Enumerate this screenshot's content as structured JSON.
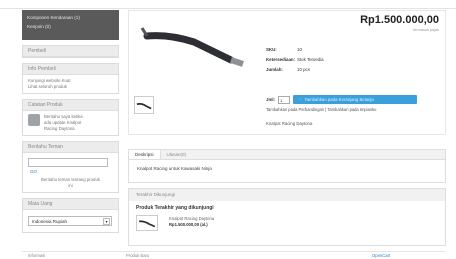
{
  "sidebar": {
    "category_items": [
      "Komponen Kendaraan (1)",
      "Kenpoin (0)"
    ],
    "checkout_title": "Pembeli",
    "buyer_info_title": "Info Pembeli",
    "buyer_info_lines": [
      "Kunjungi website Kuat",
      "Lihat seluruh produk"
    ],
    "product_note_title": "Catatan Produk",
    "product_note_text": [
      "Beritahu saya ketika",
      "ada update Knalpot",
      "Racing Daytona"
    ],
    "notify_friend_title": "Beritahu Teman",
    "notify_friend_button": "GO",
    "notify_friend_text": [
      "Beritahu teman tentang produk",
      "ini"
    ],
    "currency_title": "Mata Uang",
    "currency_selected": "Indonesia Rupiah"
  },
  "product": {
    "price": "Rp1.500.000,00",
    "price_note": "termasuk pajak",
    "sku_label": "SKU:",
    "sku_value": "10",
    "availability_label": "Ketersediaan:",
    "availability_value": "Stok Tersedia",
    "quantity_label": "Jumlah:",
    "quantity_value": "10 pcs",
    "qty_label": "Jml:",
    "qty_input": "1",
    "add_to_cart": "Tambahkan pada Keranjang Belanja",
    "links": "Tambahkan pada Perbandingan | Tambahkan pada Impianku",
    "brand": "Knalpot Racing Daytona"
  },
  "tabs": {
    "items": [
      "Deskripsi",
      "Ulasan(0)"
    ],
    "description": "Knalpot Racing untuk Kawasaki Ninja"
  },
  "recently_viewed": {
    "header": "Terakhir Dikunjungi",
    "title": "Produk Terakhir yang dikunjungi",
    "item_name": "Knalpot Racing Daytona",
    "item_price": "Rp1.500.000,00 (al.)"
  },
  "footer": {
    "items": [
      "Informasi",
      "Produk Baru",
      "OpenCart"
    ]
  },
  "colors": {
    "accent": "#3aa0dc",
    "sidebar_dark": "#5a5a5a"
  }
}
